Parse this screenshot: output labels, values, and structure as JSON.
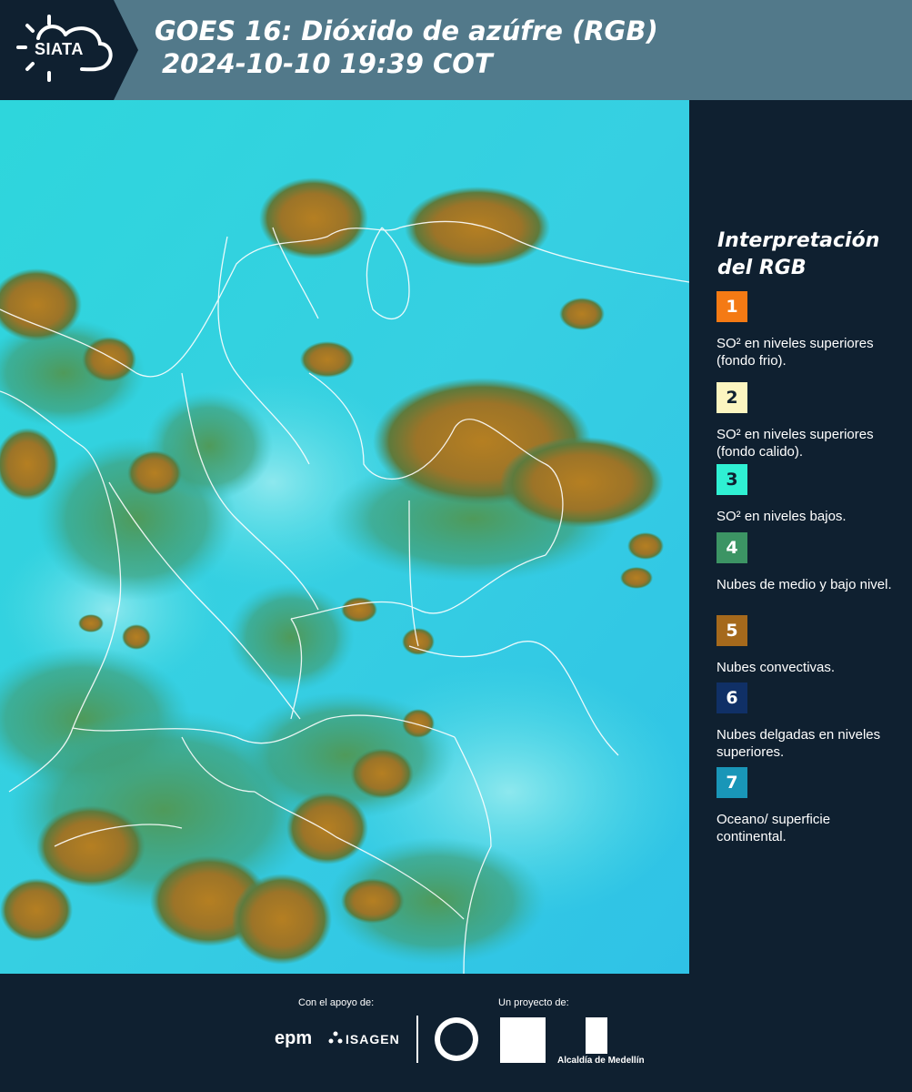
{
  "header": {
    "logo_text": "SIATA",
    "title_line1": "GOES 16: Dióxido de azúfre (RGB)",
    "title_line2": "2024-10-10 19:39 COT"
  },
  "legend": {
    "title_line1": "Interpretación",
    "title_line2": "del RGB",
    "items": [
      {
        "number": "1",
        "label": "SO² en niveles superiores (fondo frio).",
        "color": "#f47a14",
        "text_color": "#ffffff"
      },
      {
        "number": "2",
        "label": "SO² en niveles superiores (fondo calido).",
        "color": "#fcf5c0",
        "text_color": "#0f2030"
      },
      {
        "number": "3",
        "label": "SO² en niveles bajos.",
        "color": "#2ff0d3",
        "text_color": "#0f2030"
      },
      {
        "number": "4",
        "label": "Nubes de medio y bajo nivel.",
        "color": "#3c9464",
        "text_color": "#ffffff"
      },
      {
        "number": "5",
        "label": "Nubes convectivas.",
        "color": "#a5691c",
        "text_color": "#ffffff"
      },
      {
        "number": "6",
        "label": "Nubes delgadas en niveles superiores.",
        "color": "#103066",
        "text_color": "#ffffff"
      },
      {
        "number": "7",
        "label": "Oceano/ superficie continental.",
        "color": "#1996b8",
        "text_color": "#ffffff"
      }
    ]
  },
  "footer": {
    "support_label": "Con el apoyo de:",
    "project_label": "Un proyecto de:",
    "epm": "epm",
    "isagen": "ISAGEN",
    "alcaldia": "Alcaldía de Medellín"
  }
}
